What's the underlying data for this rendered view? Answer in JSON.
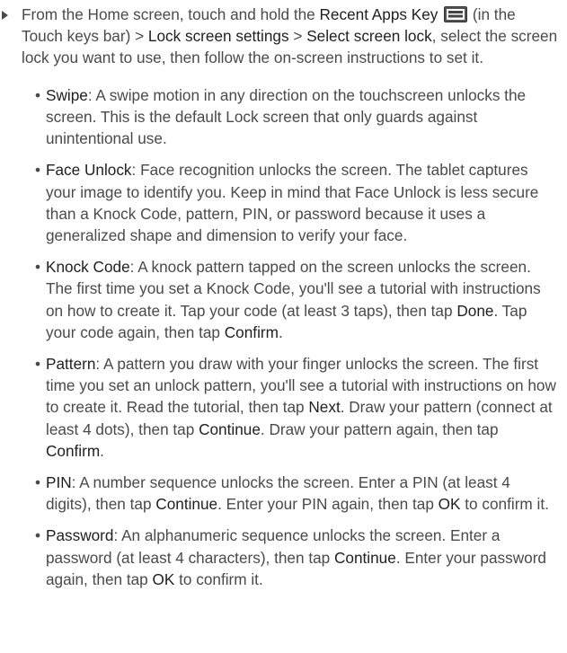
{
  "intro": {
    "p1": "From the Home screen, touch and hold the ",
    "recent_apps_key": "Recent Apps Key",
    "p2": " (in the Touch keys bar) > ",
    "lock_screen_settings": "Lock screen settings",
    "p3": " > ",
    "select_screen_lock": "Select screen lock",
    "p4": ", select the screen lock you want to use, then follow the on-screen instructions to set it."
  },
  "key_icon": "recent-apps-key-icon",
  "items": {
    "swipe": {
      "term": "Swipe",
      "t1": ": A swipe motion in any direction on the touchscreen unlocks the screen. This is the default Lock screen that only guards against unintentional use."
    },
    "face": {
      "term": "Face Unlock",
      "t1": ": Face recognition unlocks the screen. The tablet captures your image to identify you. Keep in mind that Face Unlock is less secure than a Knock Code, pattern, PIN, or password because it uses a generalized shape and dimension to verify your face."
    },
    "knock": {
      "term": "Knock Code",
      "t1": ": A knock pattern tapped on the screen unlocks the screen. The first time you set a Knock Code, you'll see a tutorial with instructions on how to create it. Tap your code (at least 3 taps), then tap ",
      "done": "Done",
      "t2": ". Tap your code again, then tap ",
      "confirm": "Confirm",
      "t3": "."
    },
    "pattern": {
      "term": "Pattern",
      "t1": ": A pattern you draw with your finger unlocks the screen. The first time you set an unlock pattern, you'll see a tutorial with instructions on how to create it. Read the tutorial, then tap ",
      "next": "Next",
      "t2": ". Draw your pattern (connect at least 4 dots), then tap ",
      "continue": "Continue",
      "t3": ". Draw your pattern again, then tap ",
      "confirm": "Confirm",
      "t4": "."
    },
    "pin": {
      "term": "PIN",
      "t1": ": A number sequence unlocks the screen. Enter a PIN (at least 4 digits), then tap ",
      "continue": "Continue",
      "t2": ". Enter your PIN again, then tap ",
      "ok": "OK",
      "t3": " to confirm it."
    },
    "password": {
      "term": "Password",
      "t1": ": An alphanumeric sequence unlocks the screen. Enter a password (at least 4 characters), then tap ",
      "continue": "Continue",
      "t2": ". Enter your password again, then tap ",
      "ok": "OK",
      "t3": " to confirm it."
    }
  }
}
